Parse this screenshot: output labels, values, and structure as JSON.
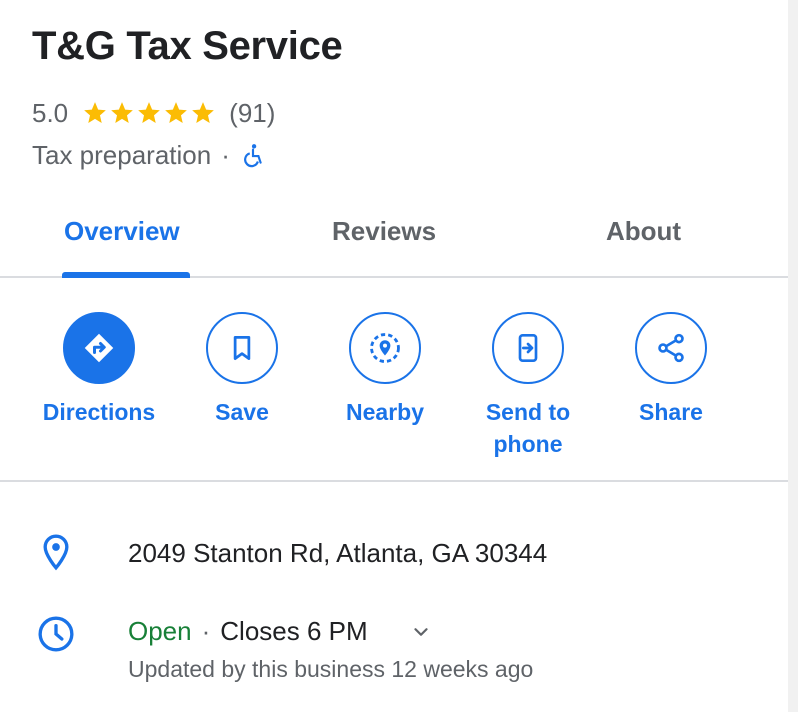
{
  "place": {
    "name": "T&G Tax Service",
    "rating": "5.0",
    "stars": 5,
    "review_count": "(91)",
    "category": "Tax preparation",
    "separator": "·"
  },
  "tabs": [
    {
      "label": "Overview",
      "active": true
    },
    {
      "label": "Reviews",
      "active": false
    },
    {
      "label": "About",
      "active": false
    }
  ],
  "actions": {
    "directions": "Directions",
    "save": "Save",
    "nearby": "Nearby",
    "send_to_phone_line1": "Send to",
    "send_to_phone_line2": "phone",
    "share": "Share"
  },
  "info": {
    "address": "2049 Stanton Rd, Atlanta, GA 30344",
    "open_status": "Open",
    "separator": "·",
    "closes": "Closes 6 PM",
    "updated": "Updated by this business 12 weeks ago"
  },
  "icons": {
    "star": "star-icon",
    "accessibility": "wheelchair-icon",
    "directions": "directions-icon",
    "save": "bookmark-icon",
    "nearby": "nearby-icon",
    "send": "send-to-phone-icon",
    "share": "share-icon",
    "address": "location-pin-icon",
    "hours": "clock-icon",
    "expand": "chevron-down-icon"
  },
  "colors": {
    "accent": "#1a73e8",
    "star": "#fbbc04",
    "open": "#188038",
    "text": "#202124",
    "muted": "#5f6368",
    "divider": "#dadce0"
  }
}
